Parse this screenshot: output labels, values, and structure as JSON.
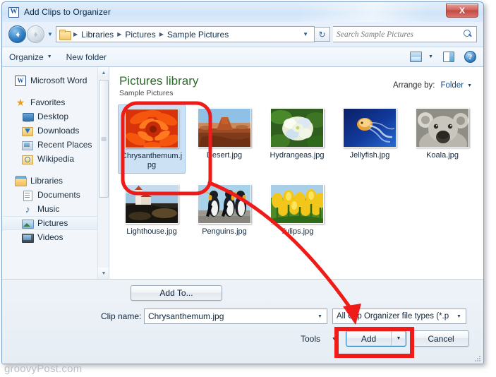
{
  "window": {
    "title": "Add Clips to Organizer",
    "app_icon": "word-icon",
    "app_icon_letter": "W",
    "close_label": "X"
  },
  "address_bar": {
    "back_icon": "back-arrow-icon",
    "forward_icon": "forward-arrow-icon",
    "history_caret": "▼",
    "folder_icon": "folder-icon",
    "breadcrumbs": [
      "Libraries",
      "Pictures",
      "Sample Pictures"
    ],
    "separator": "▶",
    "dropdown_caret": "▼",
    "refresh_icon": "↻",
    "search_placeholder": "Search Sample Pictures",
    "search_value": "",
    "search_icon": "magnifier-icon"
  },
  "command_bar": {
    "organize_label": "Organize",
    "organize_caret": "▼",
    "new_folder_label": "New folder",
    "view_icon": "view-layout-icon",
    "view_caret": "▼",
    "preview_pane_icon": "preview-pane-icon",
    "help_icon": "help-icon",
    "help_glyph": "?"
  },
  "nav_pane": {
    "groups": [
      {
        "items": [
          {
            "label": "Microsoft Word",
            "icon": "word-icon",
            "level": 0,
            "selected": false
          }
        ]
      },
      {
        "items": [
          {
            "label": "Favorites",
            "icon": "star-icon",
            "level": 0,
            "selected": false
          },
          {
            "label": "Desktop",
            "icon": "desktop-icon",
            "level": 1,
            "selected": false
          },
          {
            "label": "Downloads",
            "icon": "downloads-icon",
            "level": 1,
            "selected": false
          },
          {
            "label": "Recent Places",
            "icon": "recent-places-icon",
            "level": 1,
            "selected": false
          },
          {
            "label": "Wikipedia",
            "icon": "wikipedia-icon",
            "level": 1,
            "selected": false
          }
        ]
      },
      {
        "items": [
          {
            "label": "Libraries",
            "icon": "libraries-icon",
            "level": 0,
            "selected": false
          },
          {
            "label": "Documents",
            "icon": "documents-icon",
            "level": 1,
            "selected": false
          },
          {
            "label": "Music",
            "icon": "music-icon",
            "level": 1,
            "selected": false
          },
          {
            "label": "Pictures",
            "icon": "pictures-icon",
            "level": 1,
            "selected": true
          },
          {
            "label": "Videos",
            "icon": "videos-icon",
            "level": 1,
            "selected": false
          }
        ]
      }
    ],
    "scroll_up": "▲",
    "scroll_down": "▼"
  },
  "library_header": {
    "title": "Pictures library",
    "subtitle": "Sample Pictures",
    "arrange_label": "Arrange by:",
    "arrange_value": "Folder",
    "arrange_caret": "▼"
  },
  "files": [
    {
      "name": "Chrysanthemum.jpg",
      "thumb": "chrysanthemum",
      "selected": true
    },
    {
      "name": "Desert.jpg",
      "thumb": "desert",
      "selected": false
    },
    {
      "name": "Hydrangeas.jpg",
      "thumb": "hydrangeas",
      "selected": false
    },
    {
      "name": "Jellyfish.jpg",
      "thumb": "jellyfish",
      "selected": false
    },
    {
      "name": "Koala.jpg",
      "thumb": "koala",
      "selected": false
    },
    {
      "name": "Lighthouse.jpg",
      "thumb": "lighthouse",
      "selected": false
    },
    {
      "name": "Penguins.jpg",
      "thumb": "penguins",
      "selected": false
    },
    {
      "name": "Tulips.jpg",
      "thumb": "tulips",
      "selected": false
    }
  ],
  "footer": {
    "add_to_label": "Add To...",
    "clip_name_label": "Clip name:",
    "clip_name_value": "Chrysanthemum.jpg",
    "clip_name_caret": "▼",
    "file_type_value": "All Clip Organizer file types  (*.p",
    "file_type_caret": "▼",
    "tools_label": "Tools",
    "tools_caret": "▼",
    "add_label": "Add",
    "add_caret": "▼",
    "cancel_label": "Cancel"
  },
  "annotations": {
    "color": "#ee1b18",
    "highlight_file": "Chrysanthemum.jpg",
    "highlight_button": "Add"
  },
  "watermark": {
    "text": "groovyPost.com"
  }
}
